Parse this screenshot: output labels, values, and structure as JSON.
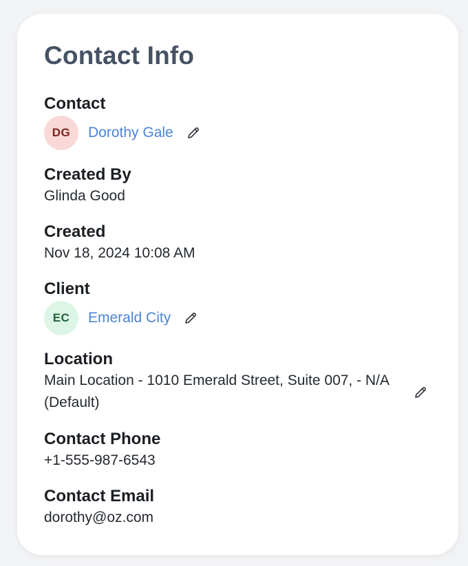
{
  "card": {
    "title": "Contact Info"
  },
  "fields": {
    "contact": {
      "label": "Contact",
      "avatar_initials": "DG",
      "name": "Dorothy Gale"
    },
    "created_by": {
      "label": "Created By",
      "value": "Glinda Good"
    },
    "created": {
      "label": "Created",
      "value": "Nov 18, 2024 10:08 AM"
    },
    "client": {
      "label": "Client",
      "avatar_initials": "EC",
      "name": "Emerald City"
    },
    "location": {
      "label": "Location",
      "value": "Main Location - 1010 Emerald Street, Suite 007, - N/A (Default)"
    },
    "contact_phone": {
      "label": "Contact Phone",
      "value": "+1-555-987-6543"
    },
    "contact_email": {
      "label": "Contact Email",
      "value": "dorothy@oz.com"
    }
  },
  "icons": {
    "edit": "pencil-icon"
  },
  "colors": {
    "link": "#4a84d6",
    "title": "#465263",
    "contact_avatar_bg": "#f8d9d7",
    "client_avatar_bg": "#ddf5e6"
  }
}
